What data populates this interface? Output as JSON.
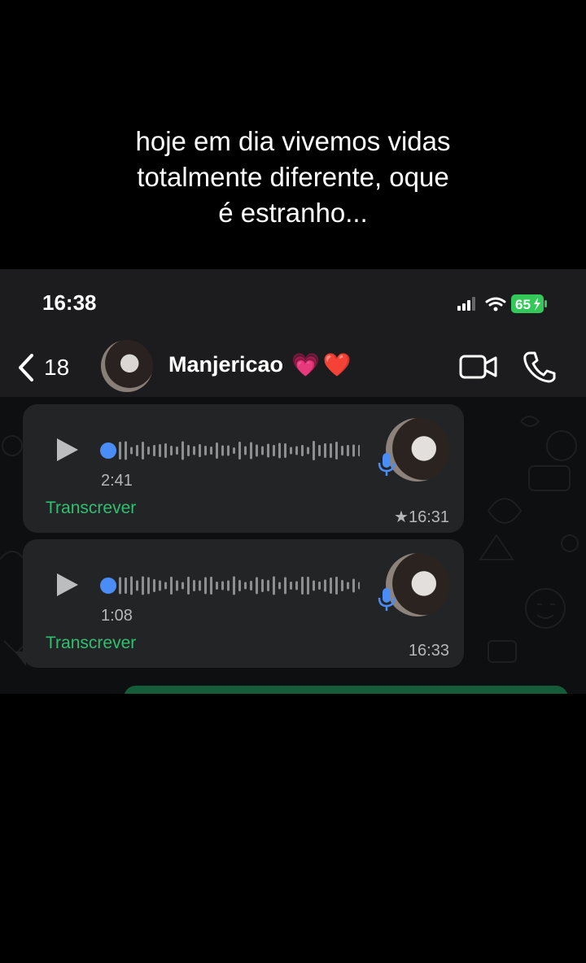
{
  "caption": {
    "line1": "hoje em dia vivemos vidas",
    "line2": "totalmente diferente, oque",
    "line3": "é estranho..."
  },
  "status_bar": {
    "time": "16:38",
    "battery": "65"
  },
  "header": {
    "back_count": "18",
    "contact_name": "Manjericao",
    "contact_emojis": "💗❤️"
  },
  "messages": [
    {
      "type": "voice",
      "duration": "2:41",
      "transcribe_label": "Transcrever",
      "time": "★16:31",
      "starred": true
    },
    {
      "type": "voice",
      "duration": "1:08",
      "transcribe_label": "Transcrever",
      "time": "16:33",
      "starred": false
    }
  ],
  "colors": {
    "accent_green": "#2fbf71",
    "voice_dot": "#4a8df6",
    "battery_green": "#34c759",
    "bubble_bg": "#232426"
  },
  "icons": [
    "back-chevron-icon",
    "video-call-icon",
    "phone-call-icon",
    "play-icon",
    "microphone-icon",
    "signal-icon",
    "wifi-icon",
    "battery-icon"
  ]
}
